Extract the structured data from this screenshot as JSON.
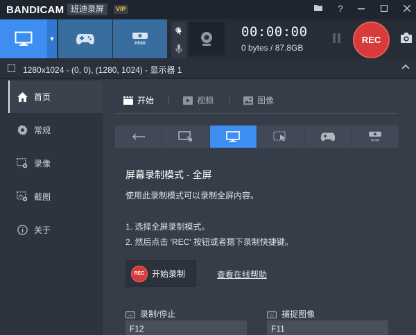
{
  "titlebar": {
    "logo_main": "BANDI",
    "logo_cam": "CAM",
    "brand_cn": "班迪录屏",
    "vip_badge": "VIP",
    "help_glyph": "?"
  },
  "toolbar": {
    "timer": "00:00:00",
    "filesize": "0 bytes / 87.8GB",
    "rec_label": "REC"
  },
  "info": {
    "capture_info": "1280x1024 - (0, 0), (1280, 1024) - 显示器 1"
  },
  "sidebar": {
    "items": [
      {
        "label": "首页",
        "icon": "home-icon"
      },
      {
        "label": "常规",
        "icon": "gear-icon"
      },
      {
        "label": "录像",
        "icon": "video-settings-icon"
      },
      {
        "label": "截图",
        "icon": "image-settings-icon"
      },
      {
        "label": "关于",
        "icon": "info-icon"
      }
    ]
  },
  "tabs": [
    {
      "label": "开始",
      "icon": "clapper-icon"
    },
    {
      "label": "视频",
      "icon": "play-icon"
    },
    {
      "label": "图像",
      "icon": "picture-icon"
    }
  ],
  "content": {
    "mode_title": "屏幕录制模式 - 全屏",
    "mode_desc": "使用此录制模式可以录制全屏内容。",
    "step1": "1. 选择全屏录制模式。",
    "step2": "2. 然后点击 'REC' 按钮或者摁下录制快捷键。",
    "start_button": "开始录制",
    "start_button_rec": "REC",
    "help_link": "查看在线帮助",
    "hotkey_record_label": "录制/停止",
    "hotkey_record_value": "F12",
    "hotkey_capture_label": "捕捉图像",
    "hotkey_capture_value": "F11"
  },
  "colors": {
    "accent_blue": "#3d8ef0",
    "rec_red": "#d93a3a",
    "background": "#2c3440",
    "panel": "#353d49"
  }
}
